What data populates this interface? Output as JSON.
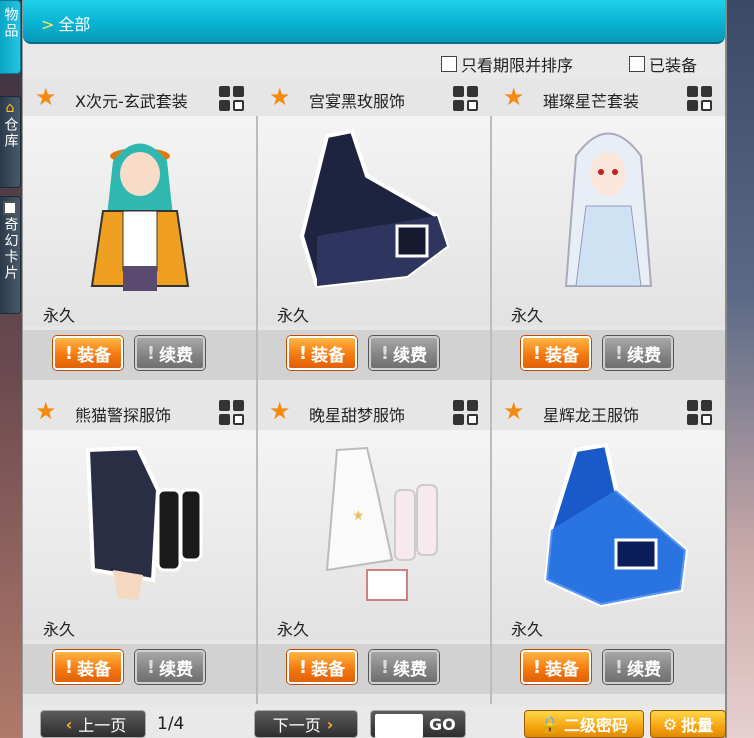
{
  "side_tabs": [
    {
      "label": "物品",
      "icon": "gift-icon",
      "active": true
    },
    {
      "label": "仓库",
      "icon": "house-icon",
      "active": false
    },
    {
      "label": "奇幻卡片",
      "icon": "card-icon",
      "active": false
    }
  ],
  "header": {
    "breadcrumb": "全部"
  },
  "filters": {
    "limited_only_label": "只看期限并排序",
    "equipped_label": "已装备"
  },
  "items": [
    {
      "name": "X次元-玄武套装",
      "duration": "永久",
      "equip_label": "装备",
      "renew_label": "续费"
    },
    {
      "name": "宫宴黑玫服饰",
      "duration": "永久",
      "equip_label": "装备",
      "renew_label": "续费"
    },
    {
      "name": "璀璨星芒套装",
      "duration": "永久",
      "equip_label": "装备",
      "renew_label": "续费"
    },
    {
      "name": "熊猫警探服饰",
      "duration": "永久",
      "equip_label": "装备",
      "renew_label": "续费"
    },
    {
      "name": "晚星甜梦服饰",
      "duration": "永久",
      "equip_label": "装备",
      "renew_label": "续费"
    },
    {
      "name": "星辉龙王服饰",
      "duration": "永久",
      "equip_label": "装备",
      "renew_label": "续费"
    }
  ],
  "pager": {
    "prev_label": "上一页",
    "next_label": "下一页",
    "page": "1/4",
    "go_label": "GO"
  },
  "actions": {
    "password_label": "二级密码",
    "batch_label": "批量"
  },
  "colors": {
    "accent": "#0ab3d3",
    "equip": "#f57a10",
    "renew": "#858585",
    "star": "#f58a12"
  }
}
